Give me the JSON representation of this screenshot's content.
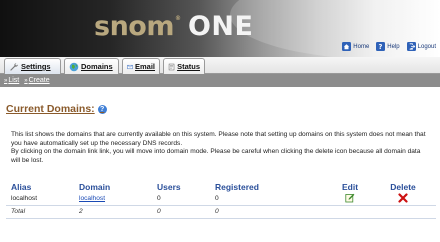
{
  "header": {
    "brand": "snom",
    "brand_mark": "®",
    "product": "ONE",
    "links": [
      {
        "label": "Home",
        "icon": "home-icon"
      },
      {
        "label": "Help",
        "icon": "help-icon"
      },
      {
        "label": "Logout",
        "icon": "logout-icon"
      }
    ]
  },
  "tabs": [
    {
      "label": "Settings",
      "icon": "wrench-icon",
      "active": true
    },
    {
      "label": "Domains",
      "icon": "globe-icon",
      "active": false
    },
    {
      "label": "Email",
      "icon": "email-icon",
      "active": false
    },
    {
      "label": "Status",
      "icon": "status-icon",
      "active": false
    }
  ],
  "subnav": [
    {
      "label": "List",
      "arrow": "»"
    },
    {
      "label": "Create",
      "arrow": "»"
    }
  ],
  "page": {
    "title": "Current Domains:",
    "help_glyph": "?",
    "description_1": "This list shows the domains that are currently available on this system. Please note that setting up domains on this system does not mean that you have automatically set up the necessary DNS records.",
    "description_2": "By clicking on the domain link link, you will move into domain mode. Please be careful when clicking the delete icon because all domain data will be lost."
  },
  "table": {
    "headers": [
      "Alias",
      "Domain",
      "Users",
      "Registered",
      "Edit",
      "Delete"
    ],
    "rows": [
      {
        "alias": "localhost",
        "domain": "localhost",
        "users": "0",
        "registered": "0"
      }
    ],
    "total": {
      "label": "Total",
      "domains": "2",
      "users": "0",
      "registered": "0"
    }
  },
  "colors": {
    "title": "#8a5a2b",
    "header_text": "#2a4f9a",
    "link": "#1a4ab5",
    "subnav_bg": "#8c8c8c",
    "brand": "#b9a87f"
  }
}
